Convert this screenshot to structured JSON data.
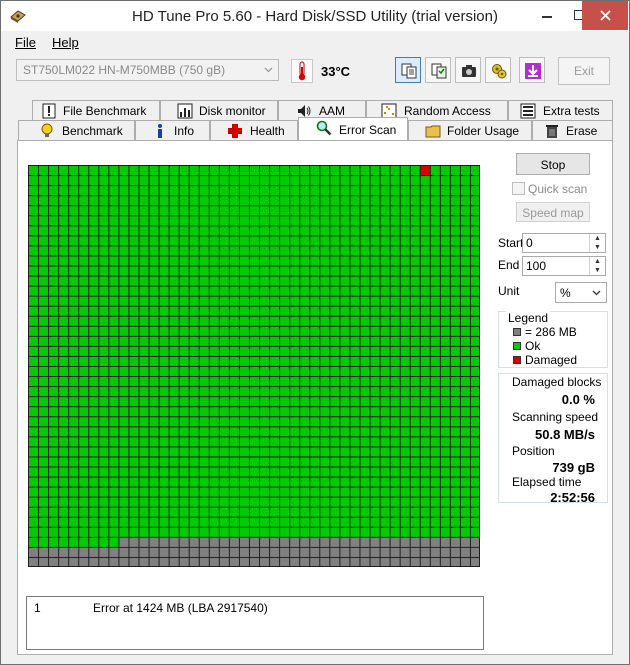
{
  "window": {
    "title": "HD Tune Pro 5.60 - Hard Disk/SSD Utility (trial version)"
  },
  "menu": {
    "file": "File",
    "help": "Help"
  },
  "toolbar": {
    "drive": "ST750LM022 HN-M750MBB (750 gB)",
    "temperature": "33°C",
    "exit_label": "Exit"
  },
  "tabs_row1": [
    {
      "label": "File Benchmark",
      "icon": "exclamation-icon"
    },
    {
      "label": "Disk monitor",
      "icon": "bar-chart-icon"
    },
    {
      "label": "AAM",
      "icon": "speaker-icon"
    },
    {
      "label": "Random Access",
      "icon": "scatter-icon"
    },
    {
      "label": "Extra tests",
      "icon": "list-icon"
    }
  ],
  "tabs_row2": [
    {
      "label": "Benchmark",
      "icon": "lightbulb-icon"
    },
    {
      "label": "Info",
      "icon": "info-icon"
    },
    {
      "label": "Health",
      "icon": "cross-icon"
    },
    {
      "label": "Error Scan",
      "icon": "magnifier-icon"
    },
    {
      "label": "Folder Usage",
      "icon": "folder-icon"
    },
    {
      "label": "Erase",
      "icon": "trash-icon"
    }
  ],
  "scan": {
    "stop_label": "Stop",
    "quick_scan_label": "Quick scan",
    "speed_map_label": "Speed map",
    "start_label": "Start",
    "start_value": "0",
    "end_label": "End",
    "end_value": "100",
    "unit_label": "Unit",
    "unit_value": "%",
    "grid": {
      "cols": 45,
      "rows": 40,
      "progress_fraction": 0.93,
      "damaged_blocks_index": [
        39
      ]
    }
  },
  "legend": {
    "title": "Legend",
    "block_size": "= 286 MB",
    "ok": "Ok",
    "damaged": "Damaged",
    "colors": {
      "ok": "#00cc00",
      "damaged": "#dd0000",
      "pending": "#808080"
    }
  },
  "stats": {
    "damaged_blocks_label": "Damaged blocks",
    "damaged_blocks_value": "0.0 %",
    "scanning_speed_label": "Scanning speed",
    "scanning_speed_value": "50.8 MB/s",
    "position_label": "Position",
    "position_value": "739 gB",
    "elapsed_label": "Elapsed time",
    "elapsed_value": "2:52:56"
  },
  "log": [
    {
      "index": "1",
      "message": "Error at 1424 MB (LBA 2917540)"
    }
  ]
}
